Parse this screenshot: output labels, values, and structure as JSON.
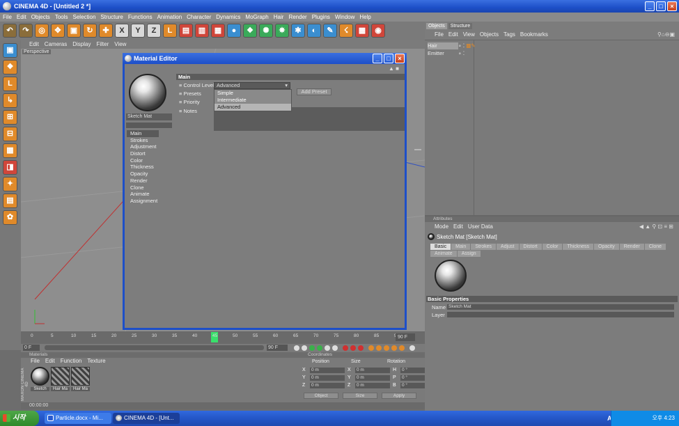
{
  "window": {
    "title": "CINEMA 4D - [Untitled 2 *]"
  },
  "menubar": [
    "File",
    "Edit",
    "Objects",
    "Tools",
    "Selection",
    "Structure",
    "Functions",
    "Animation",
    "Character",
    "Dynamics",
    "MoGraph",
    "Hair",
    "Render",
    "Plugins",
    "Window",
    "Help"
  ],
  "viewport": {
    "menu": [
      "Edit",
      "Cameras",
      "Display",
      "Filter",
      "View"
    ],
    "label": "Perspective"
  },
  "material_editor": {
    "title": "Material Editor",
    "material_name": "Sketch Mat",
    "channels": [
      "Main",
      "Strokes",
      "Adjustment",
      "Distort",
      "Color",
      "Thickness",
      "Opacity",
      "Render",
      "Clone",
      "Animate",
      "Assignment"
    ],
    "active_channel": "Main",
    "section": "Main",
    "control_level_label": "Control Level",
    "control_level_value": "Advanced",
    "presets_label": "Presets",
    "priority_label": "Priority",
    "notes_label": "Notes",
    "add_preset": "Add Preset",
    "dropdown_options": [
      "Simple",
      "Intermediate",
      "Advanced"
    ],
    "dropdown_selected": "Advanced"
  },
  "timeline": {
    "ticks": [
      "0",
      "5",
      "10",
      "15",
      "20",
      "25",
      "30",
      "35",
      "40",
      "45",
      "50",
      "55",
      "60",
      "65",
      "70",
      "75",
      "80",
      "85",
      "90"
    ],
    "current_frame": "45",
    "end_frame_field": "90 F",
    "start_field": "0 F",
    "end_field": "90 F"
  },
  "materials_manager": {
    "header": "Materials",
    "menu": [
      "File",
      "Edit",
      "Function",
      "Texture"
    ],
    "thumbnails": [
      "Sketch",
      "Hair Ma",
      "Hair Ma"
    ],
    "logo": "MAXON CINEMA 4D"
  },
  "coordinates": {
    "header": "Coordinates",
    "columns": [
      "Position",
      "Size",
      "Rotation"
    ],
    "rows": [
      {
        "axis": "X",
        "pos": "0 m",
        "size_axis": "X",
        "size": "0 m",
        "rot_axis": "H",
        "rot": "0 °"
      },
      {
        "axis": "Y",
        "pos": "0 m",
        "size_axis": "Y",
        "size": "0 m",
        "rot_axis": "P",
        "rot": "0 °"
      },
      {
        "axis": "Z",
        "pos": "0 m",
        "size_axis": "Z",
        "size": "0 m",
        "rot_axis": "B",
        "rot": "0 °"
      }
    ],
    "buttons": [
      "Object",
      "Size",
      "Apply"
    ]
  },
  "status": {
    "time": "00:00:00"
  },
  "object_manager": {
    "tabs": [
      "Objects",
      "Structure"
    ],
    "active_tab": "Objects",
    "menu": [
      "File",
      "Edit",
      "View",
      "Objects",
      "Tags",
      "Bookmarks"
    ],
    "objects": [
      {
        "name": "Hair",
        "highlighted": true
      },
      {
        "name": "Emitter",
        "highlighted": false
      }
    ]
  },
  "attributes": {
    "header": "Attributes",
    "menu": [
      "Mode",
      "Edit",
      "User Data"
    ],
    "title": "Sketch Mat [Sketch Mat]",
    "tabs": [
      "Basic",
      "Main",
      "Strokes",
      "Adjust",
      "Distort",
      "Color",
      "Thickness",
      "Opacity",
      "Render",
      "Clone",
      "Animate",
      "Assign"
    ],
    "active_tab": "Basic",
    "section": "Basic Properties",
    "name_label": "Name",
    "name_value": "Sketch Mat",
    "layer_label": "Layer"
  },
  "taskbar": {
    "start": "시작",
    "tasks": [
      "Particle.docx - Mi...",
      "CINEMA 4D - [Unt..."
    ],
    "ime": "A漢",
    "clock": "오후 4:23"
  },
  "colors": {
    "titlebar": "#1d4fc8",
    "panel": "#7c7c7c",
    "viewport": "#8e8e8e",
    "timecursor": "#39e06b"
  }
}
